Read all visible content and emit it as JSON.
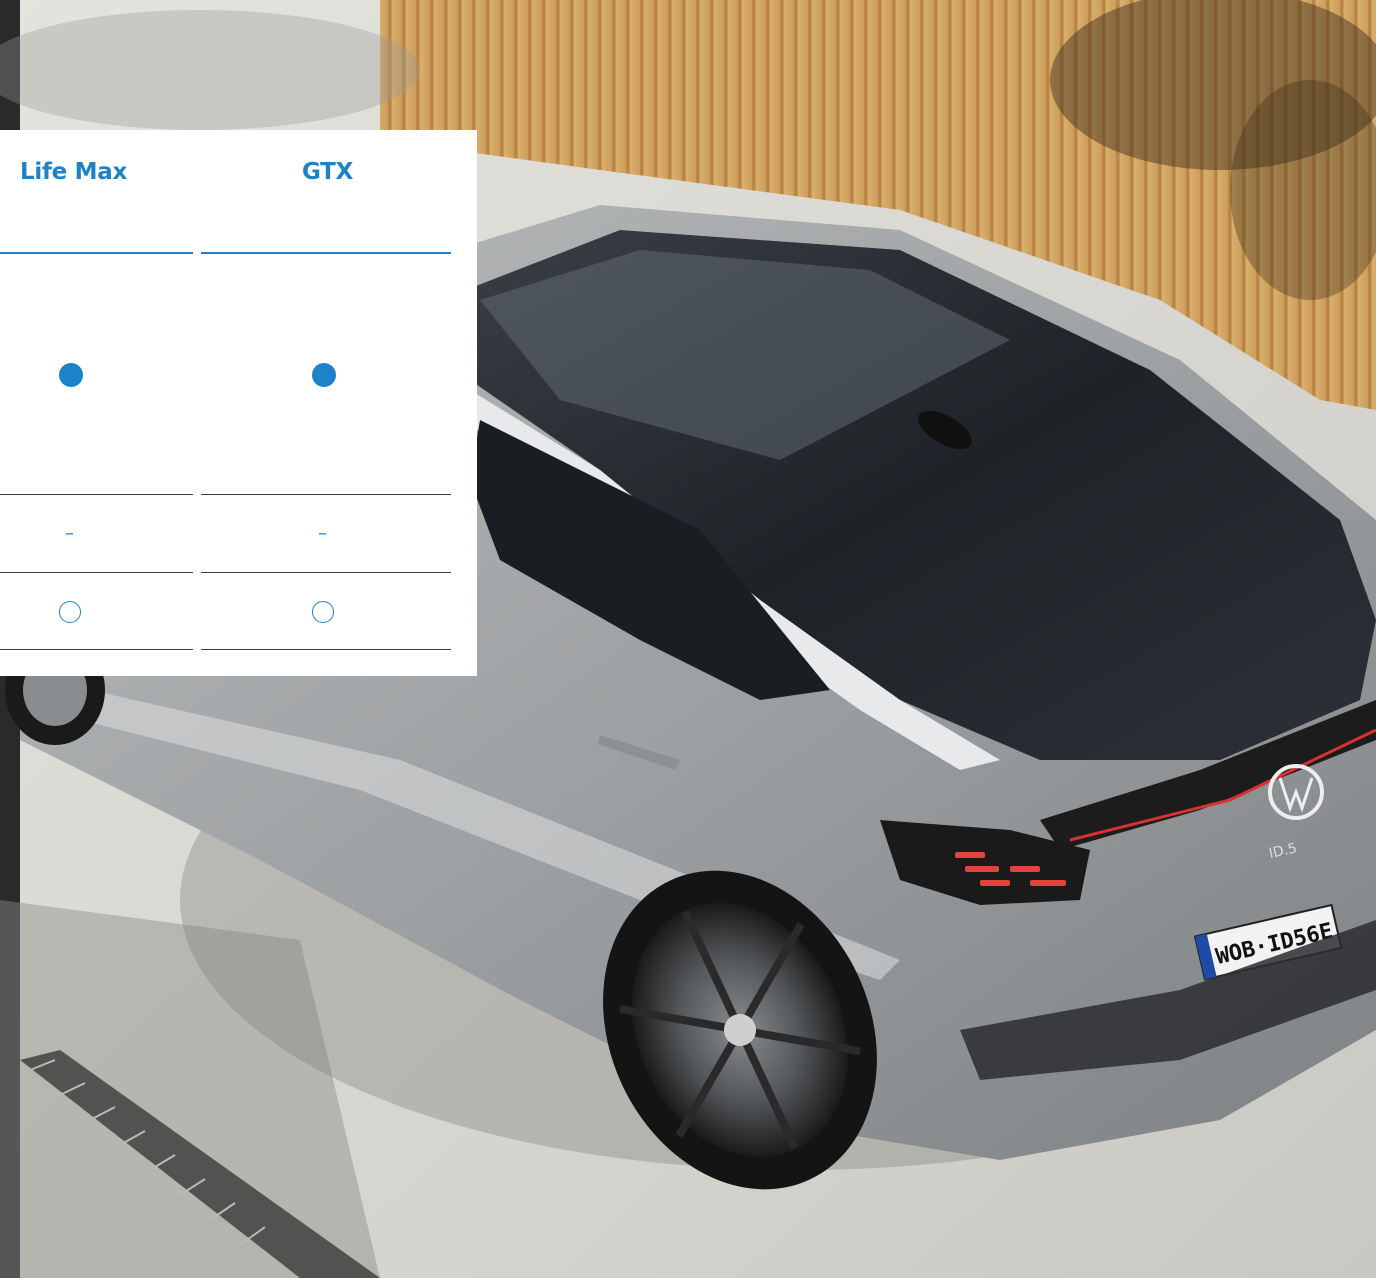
{
  "colors": {
    "accent": "#1c83c9",
    "rule": "#3e3e3e",
    "panel_bg": "#ffffff"
  },
  "comparison": {
    "columns": [
      {
        "label": "Life Max"
      },
      {
        "label": "GTX"
      }
    ],
    "rows": [
      {
        "type": "included-dot",
        "values": [
          "●",
          "●"
        ]
      },
      {
        "type": "not-available",
        "values": [
          "–",
          "–"
        ]
      },
      {
        "type": "optional-ring",
        "values": [
          "○",
          "○"
        ]
      }
    ]
  },
  "hero": {
    "badge": "ID.5",
    "plate": "WOB·ID56E"
  }
}
